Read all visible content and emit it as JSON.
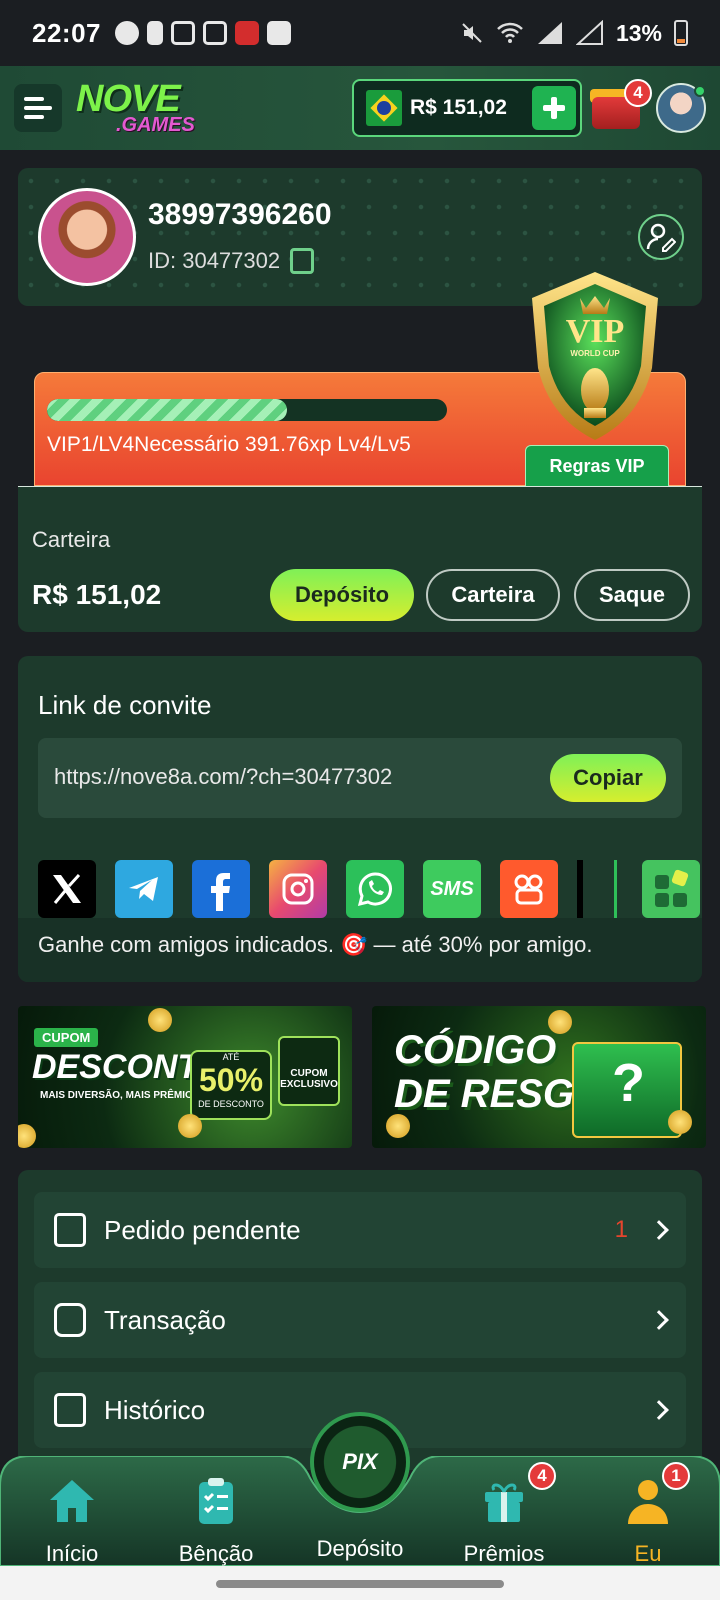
{
  "status_bar": {
    "time": "22:07",
    "battery": "13%",
    "icons": [
      "chat-bubble-icon",
      "alert-icon",
      "app-icon",
      "app-icon",
      "game-icon",
      "translate-icon",
      "mute-icon",
      "wifi-icon",
      "signal-icon",
      "signal-icon",
      "battery-icon"
    ]
  },
  "header": {
    "logo_line1": "NOVE",
    "logo_line2": ".GAMES",
    "balance": "R$ 151,02",
    "gift_badge": "4",
    "colors": {
      "accent": "#1fb351",
      "header_bg": "#1f4a35"
    }
  },
  "profile": {
    "username": "38997396260",
    "id_label": "ID: 30477302"
  },
  "vip": {
    "progress": 0.6,
    "progress_text": "VIP1/LV4Necessário 391.76xp Lv4/Lv5",
    "rules_label": "Regras VIP",
    "badge_text": "VIP",
    "badge_sub": "WORLD CUP"
  },
  "wallet": {
    "label": "Carteira",
    "amount": "R$ 151,02",
    "deposit_label": "Depósito",
    "wallet_label": "Carteira",
    "withdraw_label": "Saque"
  },
  "invite": {
    "title": "Link de convite",
    "url": "https://nove8a.com/?ch=30477302",
    "copy_label": "Copiar",
    "share": [
      "x",
      "telegram",
      "facebook",
      "instagram",
      "whatsapp",
      "sms",
      "kwai",
      "more"
    ],
    "sms_label": "SMS",
    "note": "Ganhe com amigos indicados. 🎯 — até 30% por amigo."
  },
  "banners": {
    "b1": {
      "tag": "CUPOM",
      "title": "DESCONTO",
      "subtitle": "MAIS DIVERSÃO, MAIS PRÊMIOS!",
      "pct_top": "ATÉ",
      "pct": "50%",
      "pct_sub": "DE DESCONTO",
      "coupon": "CUPOM EXCLUSIVO"
    },
    "b2": {
      "line1": "CÓDIGO",
      "line2": "DE RESGATE",
      "mark": "?"
    }
  },
  "menu": [
    {
      "label": "Pedido pendente",
      "count": "1"
    },
    {
      "label": "Transação",
      "count": ""
    },
    {
      "label": "Histórico",
      "count": ""
    }
  ],
  "bottom_nav": {
    "items": [
      {
        "label": "Início"
      },
      {
        "label": "Bênção"
      },
      {
        "label": "Depósito"
      },
      {
        "label": "Prêmios",
        "badge": "4"
      },
      {
        "label": "Eu",
        "badge": "1"
      }
    ],
    "active": "Eu",
    "pix_label": "PIX"
  }
}
